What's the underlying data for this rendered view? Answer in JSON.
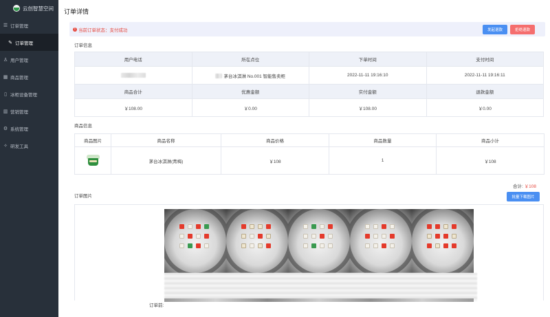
{
  "app": {
    "brand": "云创智慧空间"
  },
  "sidebar": {
    "items": [
      {
        "label": "订单管理",
        "icon": "list-icon",
        "sub": false,
        "active": false
      },
      {
        "label": "订单管理",
        "icon": "edit-icon",
        "sub": true,
        "active": true
      },
      {
        "label": "用户管理",
        "icon": "user-icon",
        "sub": false,
        "active": false
      },
      {
        "label": "商品管理",
        "icon": "grid-icon",
        "sub": false,
        "active": false
      },
      {
        "label": "冰柜设备管理",
        "icon": "device-icon",
        "sub": false,
        "active": false
      },
      {
        "label": "营销管理",
        "icon": "chart-icon",
        "sub": false,
        "active": false
      },
      {
        "label": "系统管理",
        "icon": "gear-icon",
        "sub": false,
        "active": false
      },
      {
        "label": "研发工具",
        "icon": "wrench-icon",
        "sub": false,
        "active": false
      }
    ]
  },
  "page": {
    "title": "订单详情"
  },
  "status": {
    "text": "当前订单状态：支付成功",
    "refund_button": "发起退款",
    "return_button": "拒绝退款"
  },
  "order_info": {
    "section": "订单信息",
    "headers1": [
      "用户电话",
      "所在点位",
      "下单时间",
      "支付时间"
    ],
    "values1": [
      "",
      "茅台冰淇淋 No.001 智能售卖柜",
      "2022-11-11 19:16:10",
      "2022-11-11 19:16:11"
    ],
    "headers2": [
      "商品合计",
      "优惠金额",
      "实付金额",
      "退款金额"
    ],
    "values2": [
      "￥108.00",
      "￥0.00",
      "￥108.00",
      "￥0.00"
    ]
  },
  "goods": {
    "section": "商品信息",
    "headers": [
      "商品图片",
      "商品名称",
      "商品价格",
      "商品数量",
      "商品小计"
    ],
    "rows": [
      {
        "name": "茅台冰淇淋(青梅)",
        "price": "￥108",
        "qty": "1",
        "subtotal": "￥108"
      }
    ],
    "total_label": "合计:",
    "total_value": "￥108"
  },
  "images": {
    "section": "订单图片",
    "download_button": "批量下载图片",
    "order_prefix": "订单前:"
  },
  "colors": {
    "sidebar_bg": "#28303a",
    "accent_blue": "#4a8ff2",
    "accent_red": "#f56e6e",
    "status_red": "#e5483e"
  }
}
